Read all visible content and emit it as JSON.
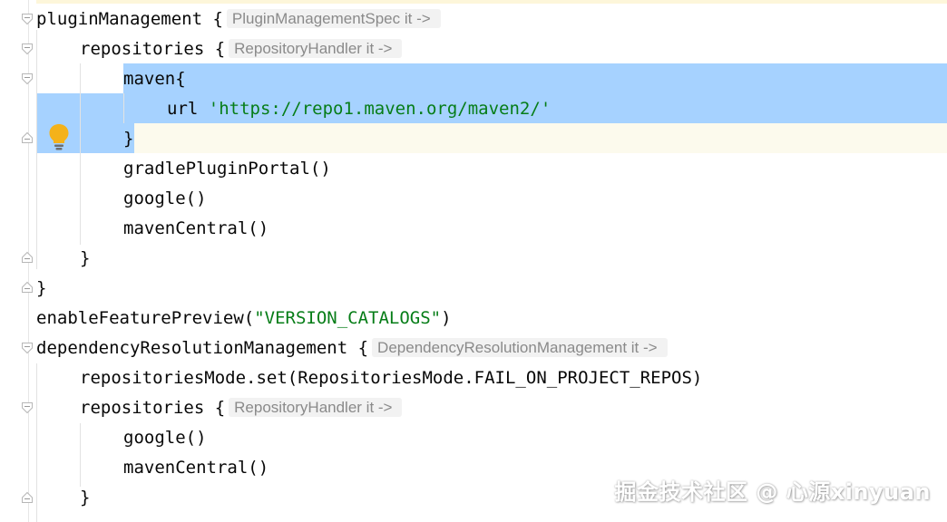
{
  "editor": {
    "lines": [
      {
        "indent": 0,
        "tokens": [
          {
            "t": "pluginManagement {"
          }
        ],
        "hint": "PluginManagementSpec it ->"
      },
      {
        "indent": 1,
        "tokens": [
          {
            "t": "repositories {"
          }
        ],
        "hint": "RepositoryHandler it ->"
      },
      {
        "indent": 2,
        "tokens": [
          {
            "t": "maven{"
          }
        ]
      },
      {
        "indent": 3,
        "tokens": [
          {
            "t": "url "
          },
          {
            "t": "'https://repo1.maven.org/maven2/'",
            "c": "str"
          }
        ]
      },
      {
        "indent": 2,
        "tokens": [
          {
            "t": "}"
          }
        ]
      },
      {
        "indent": 2,
        "tokens": [
          {
            "t": "gradlePluginPortal()"
          }
        ]
      },
      {
        "indent": 2,
        "tokens": [
          {
            "t": "google()"
          }
        ]
      },
      {
        "indent": 2,
        "tokens": [
          {
            "t": "mavenCentral()"
          }
        ]
      },
      {
        "indent": 1,
        "tokens": [
          {
            "t": "}"
          }
        ]
      },
      {
        "indent": 0,
        "tokens": [
          {
            "t": "}"
          }
        ]
      },
      {
        "indent": 0,
        "tokens": [
          {
            "t": "enableFeaturePreview("
          },
          {
            "t": "\"VERSION_CATALOGS\"",
            "c": "str"
          },
          {
            "t": ")"
          }
        ]
      },
      {
        "indent": 0,
        "tokens": [
          {
            "t": "dependencyResolutionManagement {"
          }
        ],
        "hint": "DependencyResolutionManagement it ->"
      },
      {
        "indent": 1,
        "tokens": [
          {
            "t": "repositoriesMode.set(RepositoriesMode.FAIL_ON_PROJECT_REPOS)"
          }
        ]
      },
      {
        "indent": 1,
        "tokens": [
          {
            "t": "repositories {"
          }
        ],
        "hint": "RepositoryHandler it ->"
      },
      {
        "indent": 2,
        "tokens": [
          {
            "t": "google()"
          }
        ]
      },
      {
        "indent": 2,
        "tokens": [
          {
            "t": "mavenCentral()"
          }
        ]
      },
      {
        "indent": 1,
        "tokens": [
          {
            "t": "}"
          }
        ]
      }
    ],
    "icons": {
      "fold_open": "fold-open-icon",
      "fold_close": "fold-close-icon",
      "intention": "intention-bulb-icon"
    },
    "colors": {
      "selection": "#a6d2ff",
      "current_line": "#fcfaed",
      "string": "#067d17",
      "text": "#080808",
      "hint_bg": "#f2f2f2",
      "hint_text": "#8a8a8a",
      "bulb": "#f4b21a"
    }
  },
  "watermark": {
    "text": "掘金技术社区 @ 心源xinyuan"
  }
}
